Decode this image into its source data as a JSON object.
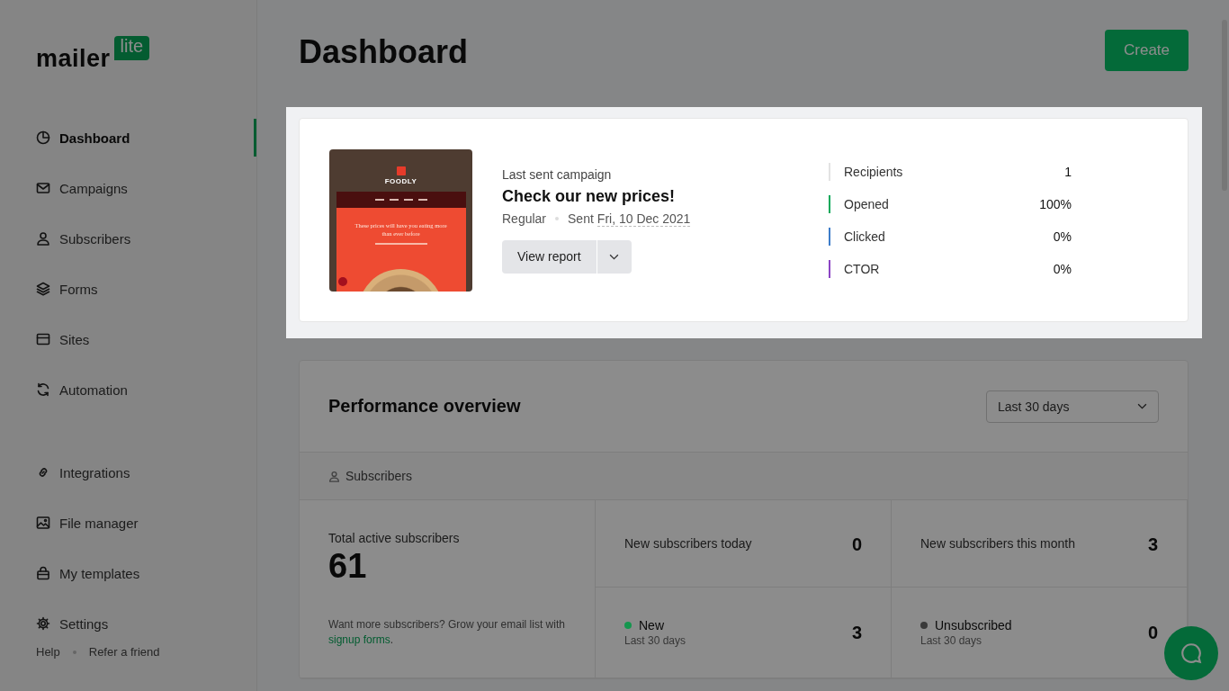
{
  "sidebar": {
    "logo": {
      "word": "mailer",
      "badge": "lite"
    },
    "nav": [
      {
        "label": "Dashboard",
        "selected": true
      },
      {
        "label": "Campaigns",
        "selected": false
      },
      {
        "label": "Subscribers",
        "selected": false
      },
      {
        "label": "Forms",
        "selected": false
      },
      {
        "label": "Sites",
        "selected": false
      },
      {
        "label": "Automation",
        "selected": false
      }
    ],
    "tools": [
      {
        "label": "Integrations",
        "selected": false
      },
      {
        "label": "File manager",
        "selected": false
      },
      {
        "label": "My templates",
        "selected": false
      },
      {
        "label": "Settings",
        "selected": false
      }
    ],
    "footer": [
      "Help",
      "Refer a friend"
    ]
  },
  "header": {
    "title": "Dashboard",
    "button": "Create"
  },
  "campaign": {
    "highlighted": true,
    "preview": {
      "brand": "FOODLY",
      "headline": "These prices will have you eating more than ever before"
    },
    "eyebrow": "Last sent campaign",
    "name": "Check our new prices!",
    "type": "Regular",
    "sent": "Sent",
    "date": "Fri, 10 Dec 2021",
    "button": "View report",
    "stats": [
      {
        "label": "Recipients",
        "value": "1",
        "color": "#e3e3e3"
      },
      {
        "label": "Opened",
        "value": "100%",
        "color": "#09a85a"
      },
      {
        "label": "Clicked",
        "value": "0%",
        "color": "#3d7cc9"
      },
      {
        "label": "CTOR",
        "value": "0%",
        "color": "#8b45c4"
      }
    ]
  },
  "performance": {
    "title": "Performance overview",
    "period": "Last 30 days",
    "tab": "Subscribers",
    "total": {
      "label": "Total active subscribers",
      "value": "61",
      "note": "Want more subscribers? Grow your email list with",
      "link": "signup forms",
      "after": "."
    },
    "cells": [
      {
        "kind": "plain",
        "label": "New subscribers today",
        "value": "0"
      },
      {
        "kind": "plain",
        "label": "New subscribers this month",
        "value": "3"
      },
      {
        "kind": "dot",
        "label": "New",
        "sub": "Last 30 days",
        "value": "3",
        "color": "#15964e"
      },
      {
        "kind": "dot",
        "label": "Unsubscribed",
        "sub": "Last 30 days",
        "value": "0",
        "color": "#3a3a3a"
      }
    ]
  }
}
